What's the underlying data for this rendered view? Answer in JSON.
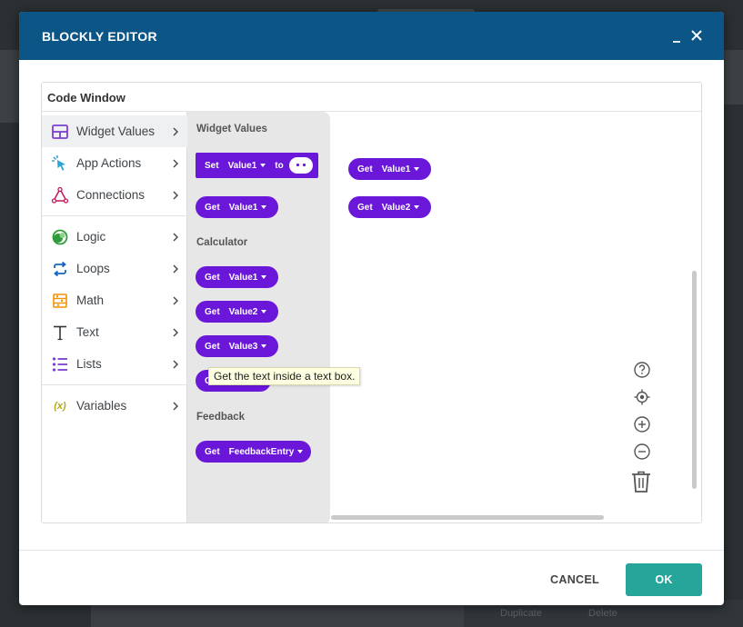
{
  "dialog": {
    "title": "BLOCKLY EDITOR",
    "minimize_label": "_",
    "close_label": "✕"
  },
  "code_window": {
    "title": "Code Window"
  },
  "toolbox": {
    "items": [
      {
        "label": "Widget Values",
        "icon": "widget-values-icon",
        "color": "#7b3fd1",
        "selected": true
      },
      {
        "label": "App Actions",
        "icon": "cursor-click-icon",
        "color": "#2aa6d6"
      },
      {
        "label": "Connections",
        "icon": "connections-triangle-icon",
        "color": "#c2185b"
      },
      {
        "label": "Logic",
        "icon": "logic-icon",
        "color": "#2e9c3a"
      },
      {
        "label": "Loops",
        "icon": "loops-icon",
        "color": "#1565c0"
      },
      {
        "label": "Math",
        "icon": "math-icon",
        "color": "#f39200"
      },
      {
        "label": "Text",
        "icon": "text-icon",
        "color": "#333333"
      },
      {
        "label": "Lists",
        "icon": "lists-icon",
        "color": "#7b3fd1"
      },
      {
        "label": "Variables",
        "icon": "variables-icon",
        "icon_text": "(x)",
        "color": "#b4a618"
      }
    ]
  },
  "flyout": {
    "headings": [
      "Widget Values",
      "Calculator",
      "Feedback"
    ],
    "set_block": {
      "keyword": "Set",
      "field": "Value1",
      "to_label": "to"
    },
    "blocks": [
      {
        "keyword": "Get",
        "field": "Value1"
      },
      {
        "keyword": "Get",
        "field": "Value1"
      },
      {
        "keyword": "Get",
        "field": "Value2"
      },
      {
        "keyword": "Get",
        "field": "Value3"
      },
      {
        "keyword": "Ge",
        "field": ""
      },
      {
        "keyword": "Get",
        "field": "FeedbackEntry"
      }
    ]
  },
  "tooltip": {
    "text": "Get the text inside a text box."
  },
  "workspace": {
    "blocks": [
      {
        "keyword": "Get",
        "field": "Value1"
      },
      {
        "keyword": "Get",
        "field": "Value2"
      }
    ],
    "controls": [
      "help-icon",
      "recenter-icon",
      "zoom-in-icon",
      "zoom-out-icon",
      "trash-icon"
    ]
  },
  "backdrop": {
    "duplicate_label": "Duplicate",
    "delete_label": "Delete"
  },
  "footer": {
    "cancel_label": "CANCEL",
    "ok_label": "OK"
  },
  "colors": {
    "header": "#0c5587",
    "block": "#6a17d9",
    "ok_button": "#26a69a",
    "flyout": "#e7e7e7"
  }
}
